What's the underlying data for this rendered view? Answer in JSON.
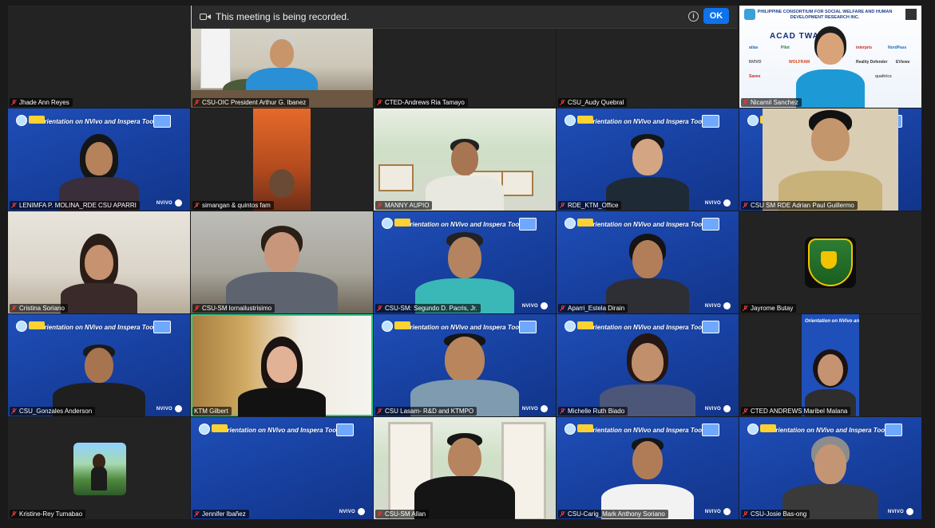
{
  "recording_banner": {
    "text": "This meeting is being recorded.",
    "ok_label": "OK",
    "info_icon": "info-icon",
    "camera_icon": "video-camera-icon"
  },
  "slide_banner": {
    "title": "Orientation on NVivo and Inspera Tools",
    "nvivo_label": "NVIVO"
  },
  "sponsor_slide": {
    "header": "PHILIPPINE CONSORTIUM FOR SOCIAL WELFARE AND HUMAN DEVELOPMENT RESEARCH INC.",
    "headline": "ACAD   TWARES",
    "vendors": [
      "atlas",
      "Pilot",
      "interpris",
      "NordPass",
      "NVIVO",
      "WOLFRAM",
      "Reality Defender",
      "EViews",
      "Saves",
      "qualtrics"
    ]
  },
  "participants": [
    {
      "name": "Jhade Ann Reyes",
      "muted": true
    },
    {
      "name": "CSU-OIC President Arthur G. Ibanez",
      "muted": true
    },
    {
      "name": "CTED-Andrews Ria Tamayo",
      "muted": true
    },
    {
      "name": "CSU_Audy Quebral",
      "muted": true
    },
    {
      "name": "Nicamil Sanchez",
      "muted": true
    },
    {
      "name": "LENIMFA P. MOLINA_RDE CSU APARRI",
      "muted": true
    },
    {
      "name": "simangan & quintos fam",
      "muted": true
    },
    {
      "name": "MANNY AUPIO",
      "muted": true
    },
    {
      "name": "RDE_KTM_Office",
      "muted": true
    },
    {
      "name": "CSU SM RDE Adrian Paul Guillermo",
      "muted": true
    },
    {
      "name": "Cristina Soriano",
      "muted": true
    },
    {
      "name": "CSU-SM lornailustrisimo",
      "muted": true
    },
    {
      "name": "CSU-SM: Segundo D. Pacris, Jr.",
      "muted": true
    },
    {
      "name": "Aparri_Estela Dirain",
      "muted": true
    },
    {
      "name": "Jayrome Butay",
      "muted": true
    },
    {
      "name": "CSU_Gonzales Anderson",
      "muted": true
    },
    {
      "name": "KTM Gilbert",
      "muted": false
    },
    {
      "name": "CSU Lasam- R&D and KTMPO",
      "muted": true
    },
    {
      "name": "Michelle Ruth Biado",
      "muted": true
    },
    {
      "name": "CTED ANDREWS Maribel Malana",
      "muted": true
    },
    {
      "name": "Kristine-Rey Tumabao",
      "muted": true
    },
    {
      "name": "Jennifer Ibañez",
      "muted": true
    },
    {
      "name": "CSU-SM Allan",
      "muted": true
    },
    {
      "name": "CSU-Carig_Mark Anthony Soriano",
      "muted": true
    },
    {
      "name": "CSU-Josie Bas-ong",
      "muted": true
    }
  ],
  "colors": {
    "active_speaker_border": "#23d18b",
    "ok_button": "#0e72ed",
    "muted_icon": "#e53935",
    "slide_blue": "#1f4fb8"
  }
}
